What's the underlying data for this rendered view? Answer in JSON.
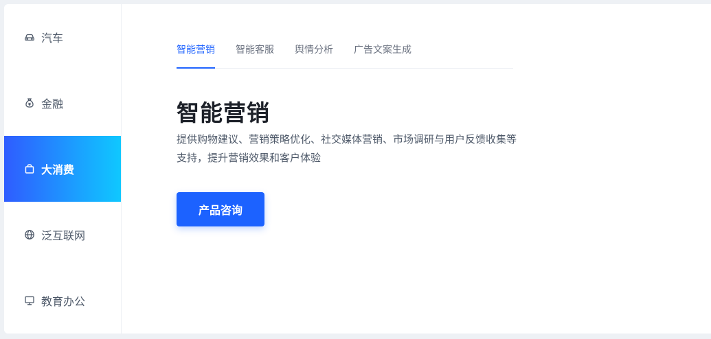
{
  "sidebar": {
    "items": [
      {
        "label": "汽车",
        "icon": "car-icon"
      },
      {
        "label": "金融",
        "icon": "money-bag-icon"
      },
      {
        "label": "大消费",
        "icon": "shopping-bag-icon",
        "active": true
      },
      {
        "label": "泛互联网",
        "icon": "globe-icon"
      },
      {
        "label": "教育办公",
        "icon": "monitor-icon"
      }
    ]
  },
  "tabs": [
    {
      "label": "智能营销",
      "active": true
    },
    {
      "label": "智能客服"
    },
    {
      "label": "舆情分析"
    },
    {
      "label": "广告文案生成"
    }
  ],
  "content": {
    "title": "智能营销",
    "description_line1": "提供购物建议、营销策略优化、社交媒体营销、市场调研与用户反馈收集等",
    "description_line2": "支持，提升营销效果和客户体验",
    "cta_label": "产品咨询"
  },
  "colors": {
    "accent": "#1f63ff",
    "active_gradient_start": "#2f5cff",
    "active_gradient_end": "#0fc8ff"
  }
}
